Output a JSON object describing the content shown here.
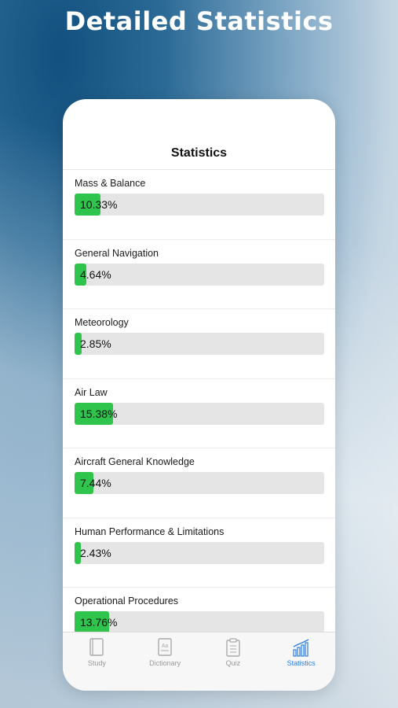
{
  "headline": "Detailed Statistics",
  "screen": {
    "title": "Statistics",
    "items": [
      {
        "label": "Mass & Balance",
        "value": "10.33%",
        "percent": 10.33
      },
      {
        "label": "General Navigation",
        "value": "4.64%",
        "percent": 4.64
      },
      {
        "label": "Meteorology",
        "value": "2.85%",
        "percent": 2.85
      },
      {
        "label": "Air Law",
        "value": "15.38%",
        "percent": 15.38
      },
      {
        "label": "Aircraft General Knowledge",
        "value": "7.44%",
        "percent": 7.44
      },
      {
        "label": "Human Performance & Limitations",
        "value": "2.43%",
        "percent": 2.43
      },
      {
        "label": "Operational Procedures",
        "value": "13.76%",
        "percent": 13.76
      }
    ]
  },
  "tabbar": {
    "tabs": [
      {
        "label": "Study",
        "icon": "book-icon",
        "active": false
      },
      {
        "label": "Dictionary",
        "icon": "dictionary-icon",
        "active": false
      },
      {
        "label": "Quiz",
        "icon": "clipboard-icon",
        "active": false
      },
      {
        "label": "Statistics",
        "icon": "chart-icon",
        "active": true
      }
    ]
  },
  "colors": {
    "progress_fill": "#2fc54c",
    "progress_track": "#e5e5e5",
    "active_tab": "#2a7de1",
    "inactive_tab": "#999999"
  }
}
